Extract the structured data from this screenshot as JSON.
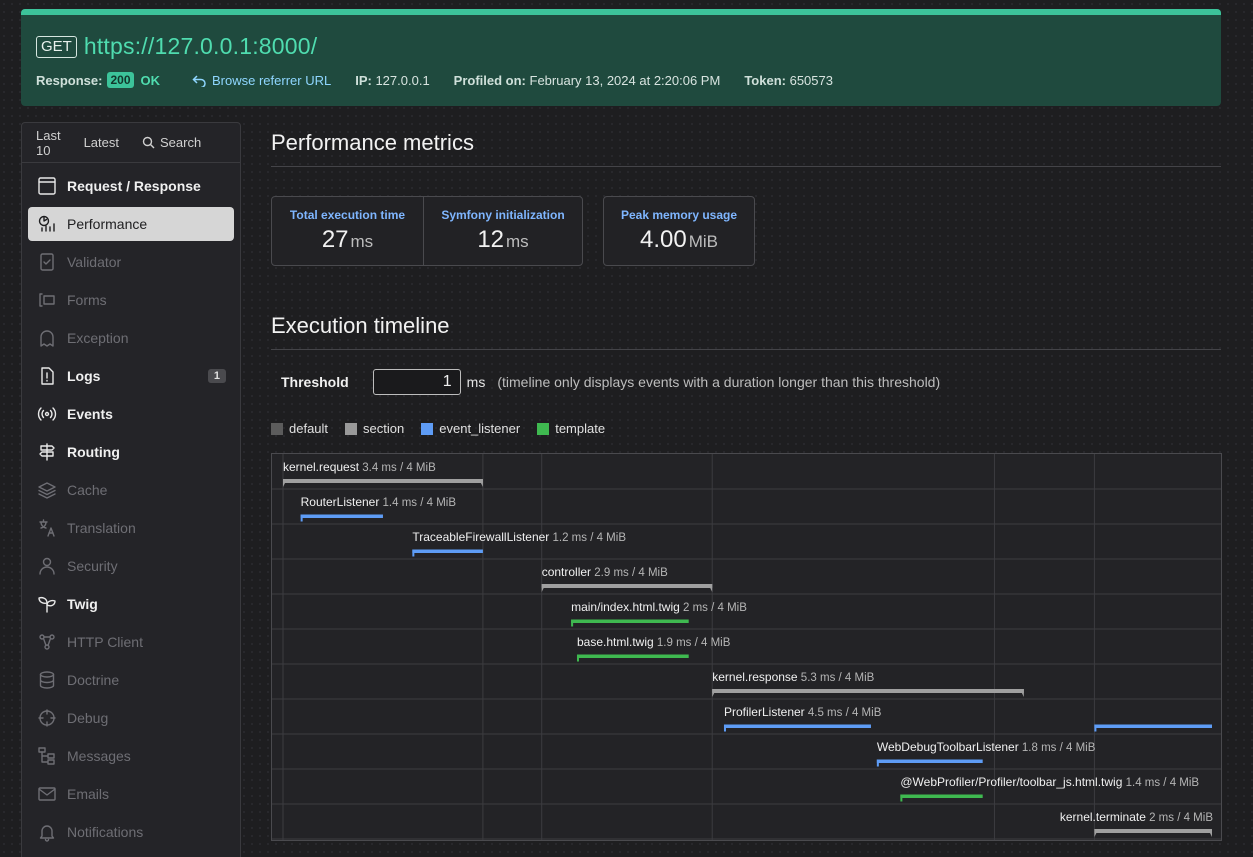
{
  "request": {
    "method": "GET",
    "url": "https://127.0.0.1:8000/",
    "response_label": "Response:",
    "status_code": "200",
    "status_text": "OK",
    "referrer_label": "Browse referrer URL",
    "ip_label": "IP:",
    "ip": "127.0.0.1",
    "profiled_label": "Profiled on:",
    "profiled_on": "February 13, 2024 at 2:20:06 PM",
    "token_label": "Token:",
    "token": "650573"
  },
  "sidebar": {
    "tabs": [
      {
        "label": "Last 10"
      },
      {
        "label": "Latest"
      },
      {
        "label": "Search",
        "icon": "search-icon"
      }
    ],
    "items": [
      {
        "label": "Request / Response",
        "icon": "window-icon",
        "enabled": true,
        "active": false
      },
      {
        "label": "Performance",
        "icon": "performance-icon",
        "enabled": true,
        "active": true
      },
      {
        "label": "Validator",
        "icon": "validator-icon",
        "enabled": false,
        "active": false
      },
      {
        "label": "Forms",
        "icon": "forms-icon",
        "enabled": false,
        "active": false
      },
      {
        "label": "Exception",
        "icon": "ghost-icon",
        "enabled": false,
        "active": false
      },
      {
        "label": "Logs",
        "icon": "log-file-icon",
        "enabled": true,
        "active": false,
        "count": "1"
      },
      {
        "label": "Events",
        "icon": "broadcast-icon",
        "enabled": true,
        "active": false
      },
      {
        "label": "Routing",
        "icon": "signpost-icon",
        "enabled": true,
        "active": false
      },
      {
        "label": "Cache",
        "icon": "layers-icon",
        "enabled": false,
        "active": false
      },
      {
        "label": "Translation",
        "icon": "translate-icon",
        "enabled": false,
        "active": false
      },
      {
        "label": "Security",
        "icon": "user-icon",
        "enabled": false,
        "active": false
      },
      {
        "label": "Twig",
        "icon": "sprout-icon",
        "enabled": true,
        "active": false
      },
      {
        "label": "HTTP Client",
        "icon": "network-icon",
        "enabled": false,
        "active": false
      },
      {
        "label": "Doctrine",
        "icon": "database-icon",
        "enabled": false,
        "active": false
      },
      {
        "label": "Debug",
        "icon": "crosshair-icon",
        "enabled": false,
        "active": false
      },
      {
        "label": "Messages",
        "icon": "hierarchy-icon",
        "enabled": false,
        "active": false
      },
      {
        "label": "Emails",
        "icon": "mail-icon",
        "enabled": false,
        "active": false
      },
      {
        "label": "Notifications",
        "icon": "bell-icon",
        "enabled": false,
        "active": false
      }
    ]
  },
  "performance": {
    "title": "Performance metrics",
    "metrics": [
      {
        "label": "Total execution time",
        "value": "27",
        "unit": "ms"
      },
      {
        "label": "Symfony initialization",
        "value": "12",
        "unit": "ms"
      },
      {
        "label": "Peak memory usage",
        "value": "4.00",
        "unit": "MiB"
      }
    ]
  },
  "timeline": {
    "title": "Execution timeline",
    "threshold_label": "Threshold",
    "threshold_value": "1",
    "threshold_unit": "ms",
    "threshold_hint": "(timeline only displays events with a duration longer than this threshold)",
    "legend": [
      {
        "label": "default",
        "color": "#5c5c5c"
      },
      {
        "label": "section",
        "color": "#999999"
      },
      {
        "label": "event_listener",
        "color": "#5e9cf5"
      },
      {
        "label": "template",
        "color": "#3fb950"
      }
    ],
    "gridlines_ms": [
      0,
      3.4,
      4.4,
      7.3,
      12.1,
      13.8
    ],
    "events": [
      {
        "name": "kernel.request",
        "detail": "3.4 ms / 4 MiB",
        "category": "section",
        "start": 0,
        "end": 3.4
      },
      {
        "name": "RouterListener",
        "detail": "1.4 ms / 4 MiB",
        "category": "event_listener",
        "start": 0.3,
        "end": 1.7
      },
      {
        "name": "TraceableFirewallListener",
        "detail": "1.2 ms / 4 MiB",
        "category": "event_listener",
        "start": 2.2,
        "end": 3.4
      },
      {
        "name": "controller",
        "detail": "2.9 ms / 4 MiB",
        "category": "section",
        "start": 4.4,
        "end": 7.3
      },
      {
        "name": "main/index.html.twig",
        "detail": "2 ms / 4 MiB",
        "category": "template",
        "start": 4.9,
        "end": 6.9
      },
      {
        "name": "base.html.twig",
        "detail": "1.9 ms / 4 MiB",
        "category": "template",
        "start": 5.0,
        "end": 6.9
      },
      {
        "name": "kernel.response",
        "detail": "5.3 ms / 4 MiB",
        "category": "section",
        "start": 7.3,
        "end": 12.6
      },
      {
        "name": "ProfilerListener",
        "detail": "4.5 ms / 4 MiB",
        "category": "event_listener",
        "start": 7.5,
        "end": 10.0,
        "extra": [
          [
            13.8,
            15.8
          ]
        ]
      },
      {
        "name": "WebDebugToolbarListener",
        "detail": "1.8 ms / 4 MiB",
        "category": "event_listener",
        "start": 10.1,
        "end": 11.9
      },
      {
        "name": "@WebProfiler/Profiler/toolbar_js.html.twig",
        "detail": "1.4 ms / 4 MiB",
        "category": "template",
        "start": 10.5,
        "end": 11.9
      },
      {
        "name": "kernel.terminate",
        "detail": "2 ms / 4 MiB",
        "category": "section",
        "start": 13.8,
        "end": 15.8
      }
    ],
    "total_ms": 15.8
  }
}
